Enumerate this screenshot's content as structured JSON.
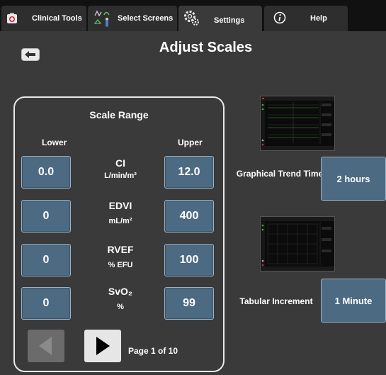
{
  "nav": {
    "tabs": [
      {
        "label": "Clinical Tools",
        "icon": "clinical-tools-icon"
      },
      {
        "label": "Select Screens",
        "icon": "select-screens-icon"
      },
      {
        "label": "Settings",
        "icon": "settings-gear-icon"
      },
      {
        "label": "Help",
        "icon": "info-icon"
      }
    ],
    "active_tab": "Settings"
  },
  "page": {
    "title": "Adjust Scales"
  },
  "scale_range": {
    "title": "Scale Range",
    "lower_header": "Lower",
    "upper_header": "Upper",
    "rows": [
      {
        "name": "CI",
        "unit": "L/min/m²",
        "lower": "0.0",
        "upper": "12.0"
      },
      {
        "name": "EDVI",
        "unit": "mL/m²",
        "lower": "0",
        "upper": "400"
      },
      {
        "name": "RVEF",
        "unit": "% EFU",
        "lower": "0",
        "upper": "100"
      },
      {
        "name": "SvO₂",
        "unit": "%",
        "lower": "0",
        "upper": "99"
      }
    ],
    "page_indicator": "Page 1 of 10"
  },
  "options": {
    "trend_time_label": "Graphical Trend Time",
    "trend_time_value": "2 hours",
    "tabular_increment_label": "Tabular Increment",
    "tabular_increment_value": "1 Minute"
  },
  "colors": {
    "value_button": "#4d6a83",
    "background": "#3a3a3a",
    "nav_background": "#111111"
  }
}
